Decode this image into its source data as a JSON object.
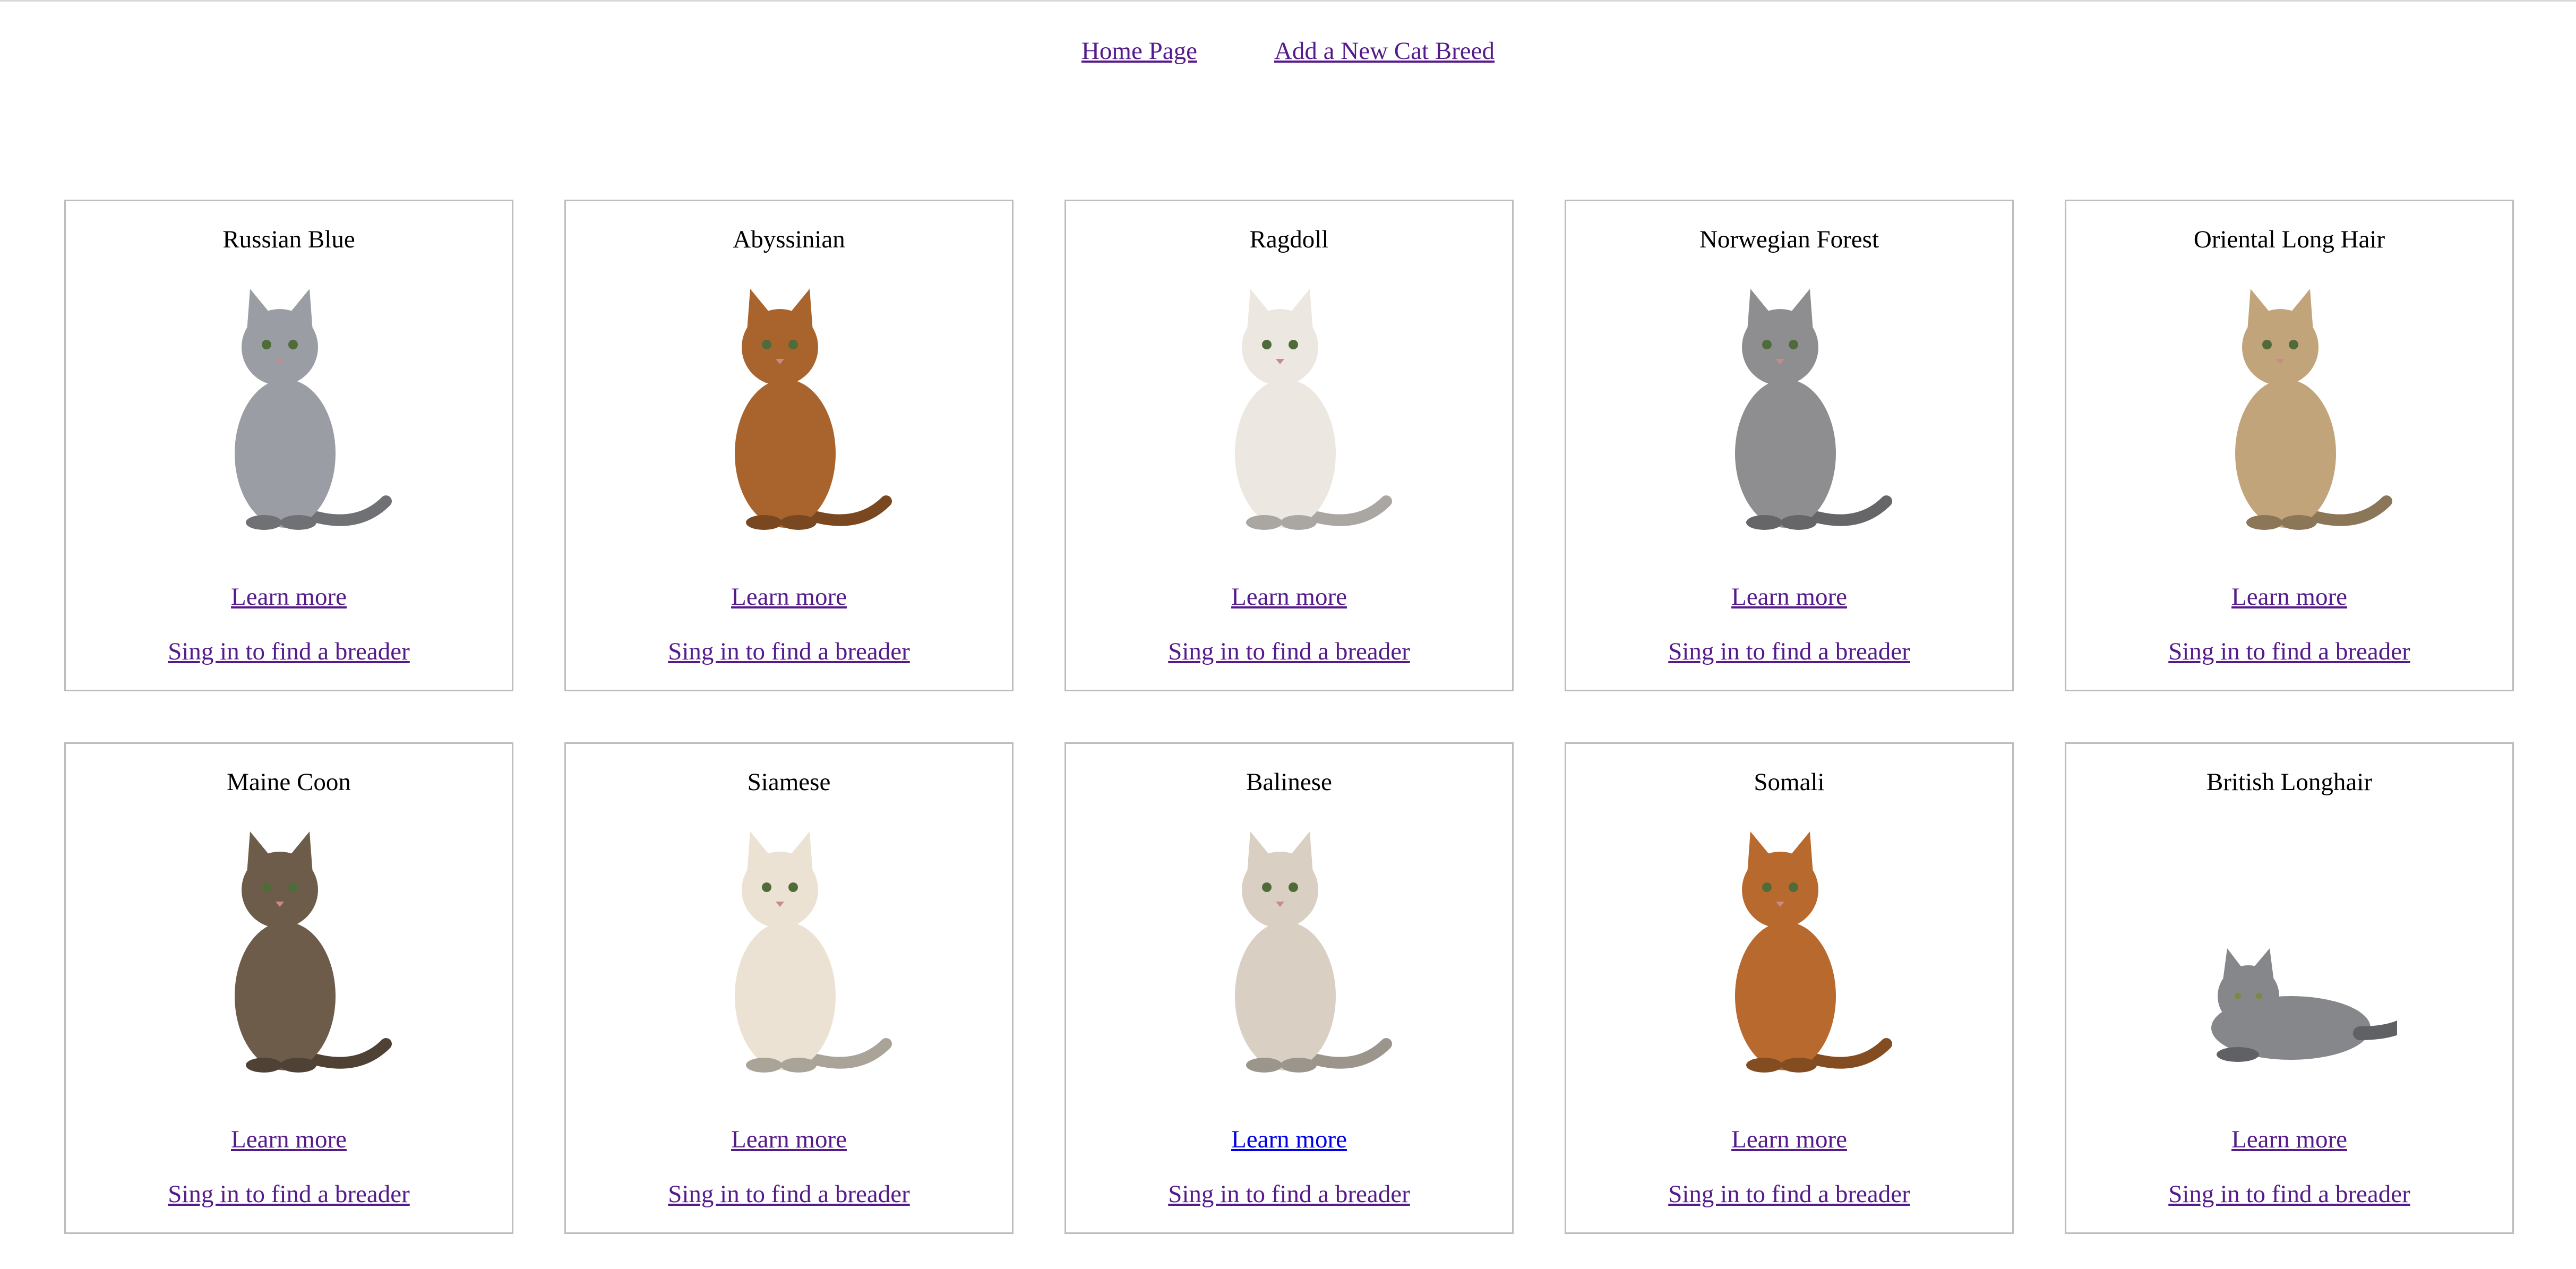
{
  "nav": {
    "home_label": "Home Page ",
    "add_label": "Add a New Cat Breed"
  },
  "cards": [
    {
      "name": "Russian Blue",
      "learn_label": "Learn more",
      "find_label": "Sing in to find a breader",
      "image": "sitting-cat-photo",
      "coat_color": "#9a9da3"
    },
    {
      "name": "Abyssinian",
      "learn_label": "Learn more",
      "find_label": "Sing in to find a breader",
      "image": "sitting-cat-photo",
      "coat_color": "#a8642c"
    },
    {
      "name": "Ragdoll",
      "learn_label": "Learn more",
      "find_label": "Sing in to find a breader",
      "image": "sitting-cat-photo",
      "coat_color": "#ece7e0"
    },
    {
      "name": "Norwegian Forest",
      "learn_label": "Learn more",
      "find_label": "Sing in to find a breader",
      "image": "sitting-cat-photo",
      "coat_color": "#8e8e90"
    },
    {
      "name": "Oriental Long Hair",
      "learn_label": "Learn more",
      "find_label": "Sing in to find a breader",
      "image": "sitting-cat-photo",
      "coat_color": "#c2a47a"
    },
    {
      "name": "Maine Coon",
      "learn_label": "Learn more",
      "find_label": "Sing in to find a breader",
      "image": "sitting-cat-photo",
      "coat_color": "#6e5c4a"
    },
    {
      "name": "Siamese",
      "learn_label": "Learn more",
      "find_label": "Sing in to find a breader",
      "image": "sitting-cat-photo",
      "coat_color": "#ebe2d3"
    },
    {
      "name": "Balinese",
      "learn_label": "Learn more",
      "find_label": "Sing in to find a breader",
      "image": "sitting-cat-photo",
      "coat_color": "#d9cfc2"
    },
    {
      "name": "Somali",
      "learn_label": "Learn more",
      "find_label": "Sing in to find a breader",
      "image": "sitting-cat-photo",
      "coat_color": "#b8692e"
    },
    {
      "name": "British Longhair",
      "learn_label": "Learn more",
      "find_label": "Sing in to find a breader",
      "image": "lying-cat-photo",
      "coat_color": "#86878b"
    }
  ],
  "colors": {
    "visited_link": "#551a8b",
    "unvisited_link": "#0000ee",
    "card_border": "#bdbdbd"
  }
}
